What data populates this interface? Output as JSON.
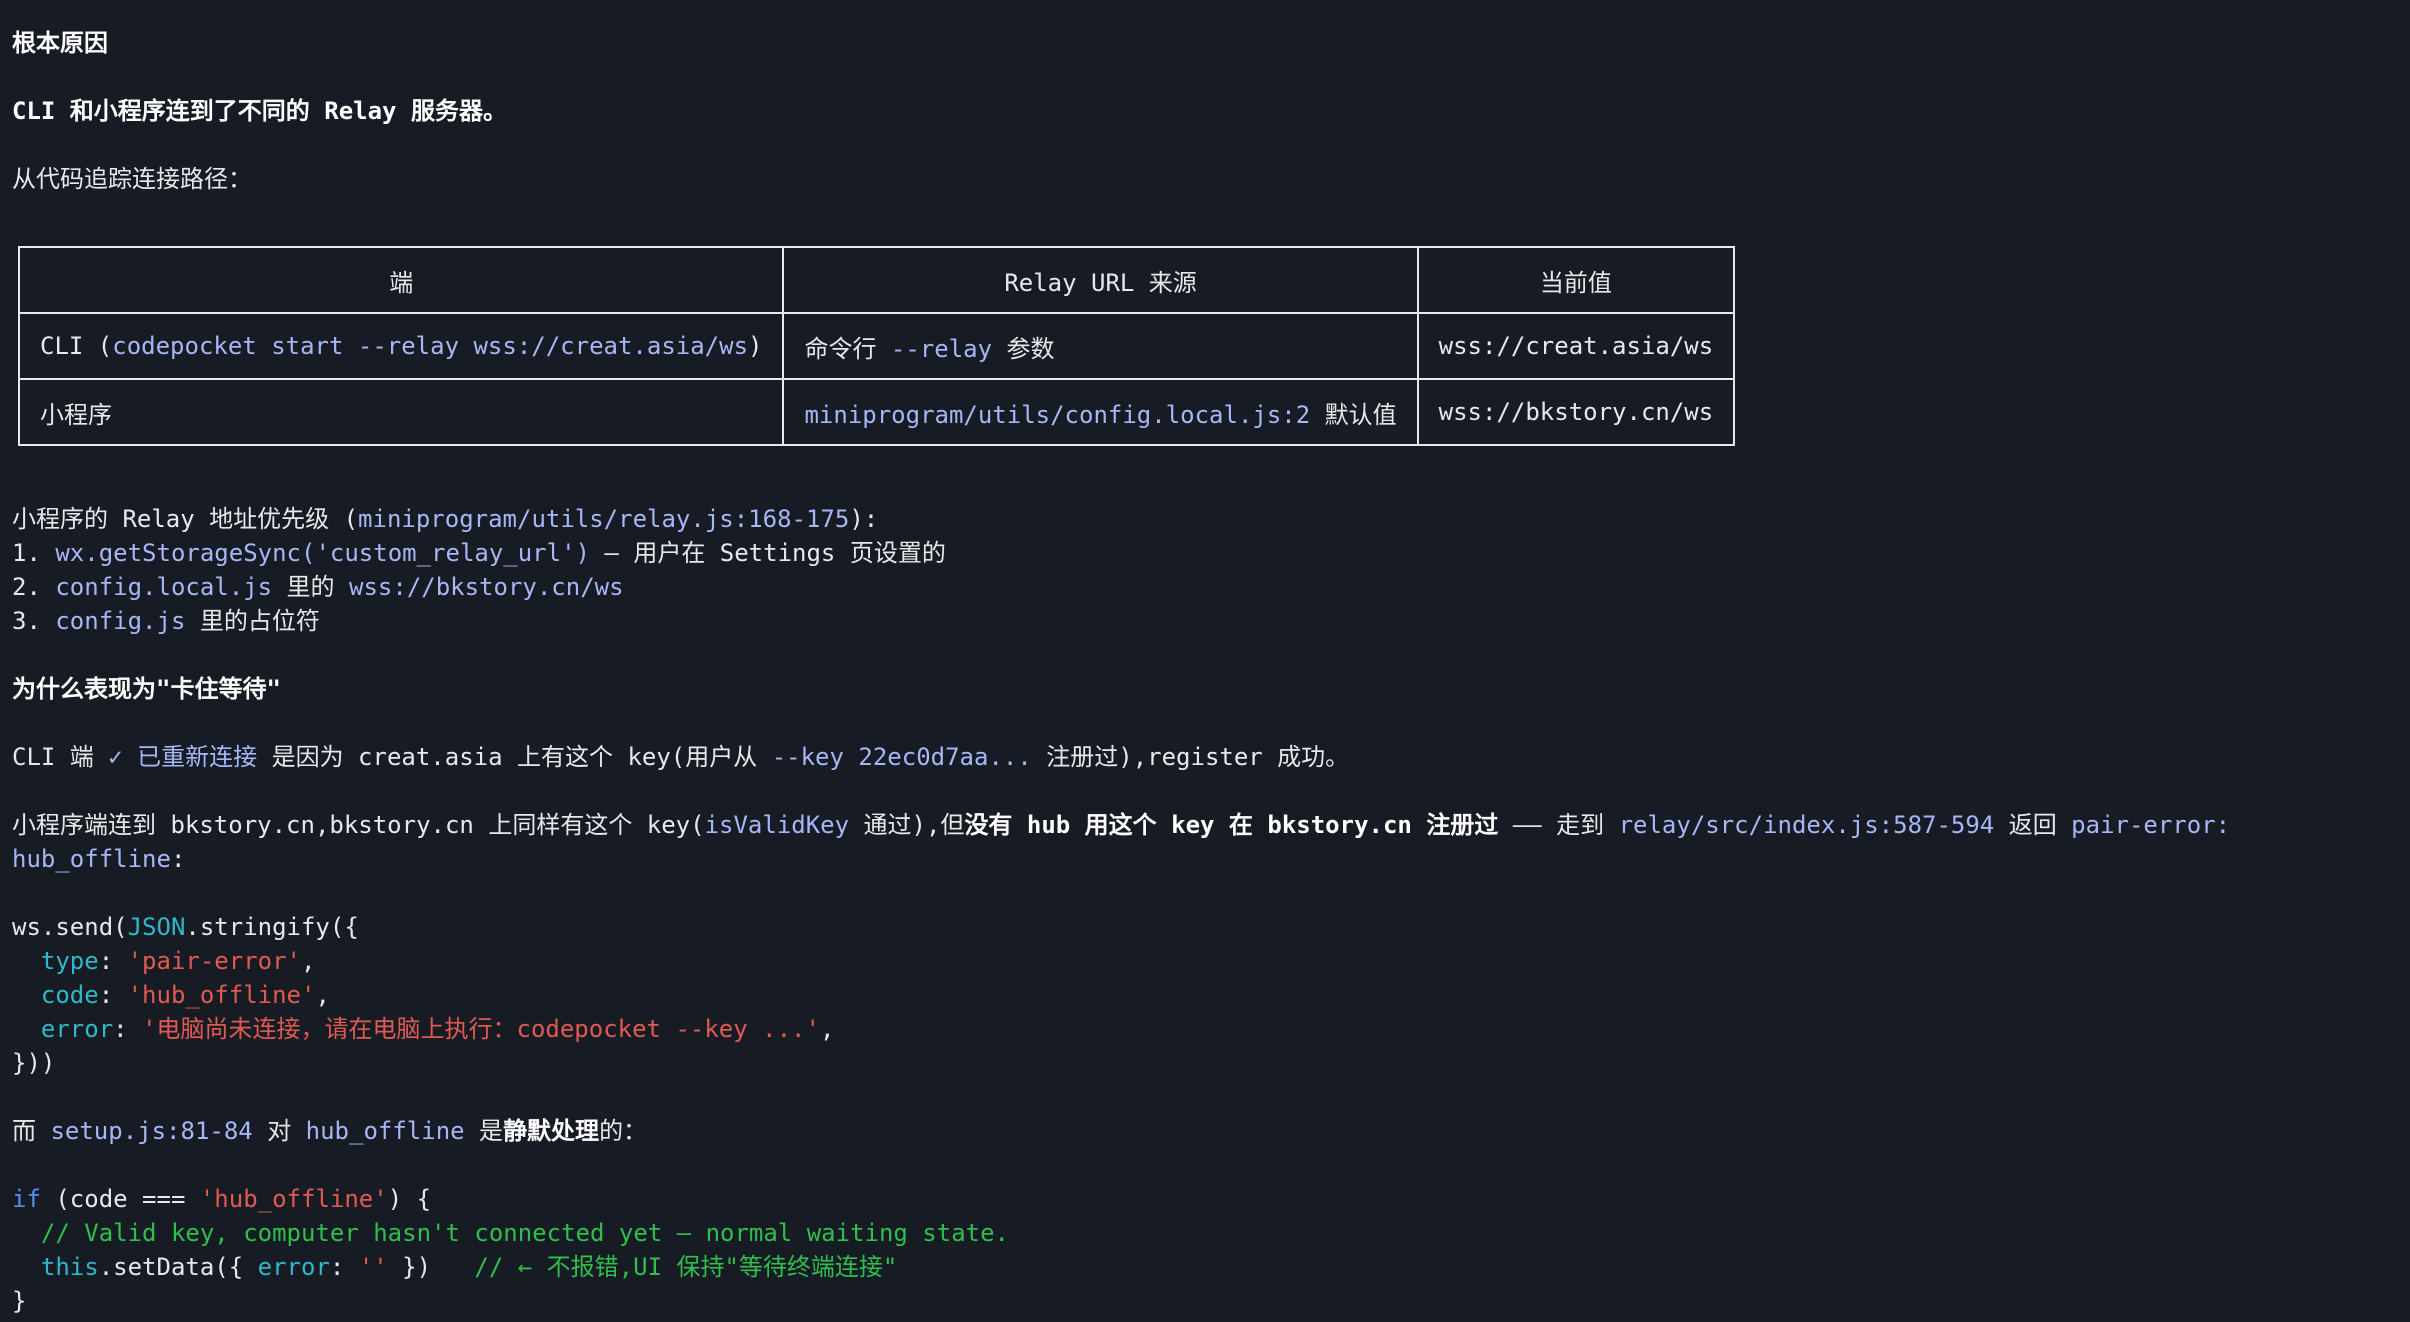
{
  "heading_root_cause": "根本原因",
  "summary_bold": "CLI 和小程序连到了不同的 Relay 服务器。",
  "trace_intro": "从代码追踪连接路径：",
  "table": {
    "headers": [
      "端",
      "Relay URL 来源",
      "当前值"
    ],
    "rows": [
      {
        "end_prefix": "CLI (",
        "end_code": "codepocket start --relay wss://creat.asia/ws",
        "end_suffix": ")",
        "source_text": "命令行 ",
        "source_code": "--relay",
        "source_suffix": " 参数",
        "value": "wss://creat.asia/ws"
      },
      {
        "end_text": "小程序",
        "source_code": "miniprogram/utils/config.local.js:2",
        "source_suffix": " 默认值",
        "value": "wss://bkstory.cn/ws"
      }
    ]
  },
  "priority": {
    "intro_prefix": "小程序的 Relay 地址优先级 (",
    "intro_code": "miniprogram/utils/relay.js:168-175",
    "intro_suffix": "):",
    "item1_num": "1. ",
    "item1_code": "wx.getStorageSync('custom_relay_url')",
    "item1_text": " — 用户在 Settings 页设置的",
    "item2_num": "2. ",
    "item2_code": "config.local.js",
    "item2_mid": " 里的 ",
    "item2_code2": "wss://bkstory.cn/ws",
    "item3_num": "3. ",
    "item3_code": "config.js",
    "item3_text": " 里的占位符"
  },
  "heading_why": "为什么表现为\"卡住等待\"",
  "cli_line": {
    "p1": "CLI 端 ",
    "code1": "✓ 已重新连接",
    "p2": " 是因为 creat.asia 上有这个 key(用户从 ",
    "code2": "--key 22ec0d7aa...",
    "p3": " 注册过),register 成功。"
  },
  "mini_line": {
    "p1": "小程序端连到 bkstory.cn,bkstory.cn 上同样有这个 key(",
    "code1": "isValidKey",
    "p2": " 通过),但",
    "bold": "没有 hub 用这个 key 在 bkstory.cn 注册过",
    "p3": " —— 走到 ",
    "code2": "relay/src/index.js:587-594",
    "p4": " 返回 ",
    "code3": "pair-error:",
    "code4": "hub_offline",
    "p5": ":"
  },
  "code_block1": {
    "l1_a": "ws.send(",
    "l1_json": "JSON",
    "l1_b": ".stringify({",
    "l2_key": "  type",
    "l2_colon": ": ",
    "l2_val": "'pair-error'",
    "l2_end": ",",
    "l3_key": "  code",
    "l3_colon": ": ",
    "l3_val": "'hub_offline'",
    "l3_end": ",",
    "l4_key": "  error",
    "l4_colon": ": ",
    "l4_val": "'电脑尚未连接，请在电脑上执行：codepocket --key ...'",
    "l4_end": ",",
    "l5": "}))"
  },
  "setup_line": {
    "p1": "而 ",
    "code1": "setup.js:81-84",
    "p2": " 对 ",
    "code2": "hub_offline",
    "p3": " 是",
    "bold": "静默处理",
    "p4": "的："
  },
  "code_block2": {
    "l1_kw": "if",
    "l1_a": " (code === ",
    "l1_str": "'hub_offline'",
    "l1_b": ") {",
    "l2_comment": "  // Valid key, computer hasn't connected yet — normal waiting state.",
    "l3_this": "  this",
    "l3_a": ".setData({ ",
    "l3_key": "error",
    "l3_b": ": ",
    "l3_str": "''",
    "l3_c": " })   ",
    "l3_comment": "// ← 不报错,UI 保持\"等待终端连接\"",
    "l4": "}"
  }
}
